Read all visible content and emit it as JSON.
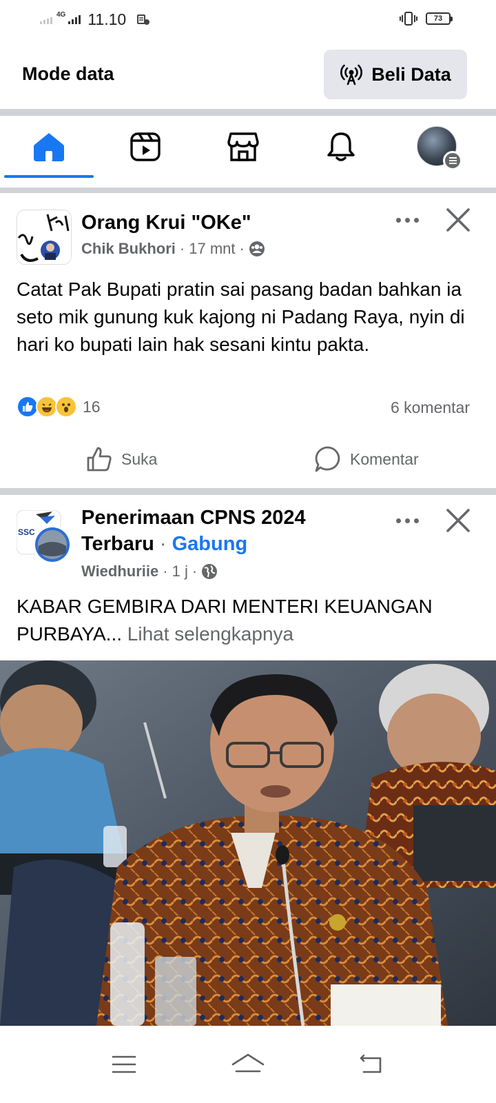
{
  "status_bar": {
    "network": "4G",
    "time": "11.10",
    "battery": "73"
  },
  "data_bar": {
    "title": "Mode data",
    "buy_button": "Beli Data"
  },
  "nav": {
    "active_tab": "home",
    "accent": "#1877f2",
    "tabs": [
      "home-icon",
      "video-icon",
      "marketplace-icon",
      "bell-icon",
      "profile-avatar"
    ]
  },
  "posts": [
    {
      "page_name": "Orang Krui \"OKe\"",
      "author": "Chik Bukhori",
      "time": "17 mnt",
      "audience_icon": "group-icon",
      "text": "Catat Pak Bupati pratin sai pasang badan bahkan ia seto mik gunung kuk kajong ni Padang Raya,  nyin di hari ko bupati lain hak sesani kintu pakta.",
      "reaction_count": "16",
      "comment_count": "6 komentar",
      "like_label": "Suka",
      "comment_label": "Komentar"
    },
    {
      "page_name_line1": "Penerimaan CPNS 2024",
      "page_name_line2": "Terbaru",
      "join_label": "Gabung",
      "author": "Wiedhuriie",
      "time": "1 j",
      "audience_icon": "globe-icon",
      "text": "KABAR GEMBIRA DARI MENTERI KEUANGAN PURBAYA...",
      "see_more": "Lihat selengkapnya"
    }
  ]
}
